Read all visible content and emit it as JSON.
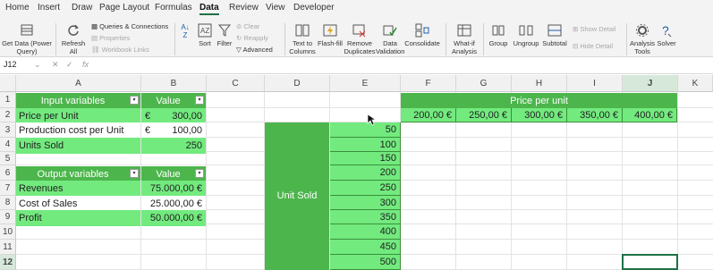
{
  "ribbon_tabs": [
    "Home",
    "Insert",
    "Draw",
    "Page Layout",
    "Formulas",
    "Data",
    "Review",
    "View",
    "Developer"
  ],
  "active_tab": "Data",
  "ribbon": {
    "get_data": "Get Data (Power Query)",
    "refresh_all": "Refresh All",
    "queries": "Queries & Connections",
    "properties": "Properties",
    "workbook_links": "Workbook Links",
    "sort": "Sort",
    "filter": "Filter",
    "clear": "Clear",
    "reapply": "Reapply",
    "advanced": "Advanced",
    "text_to_columns": "Text to Columns",
    "flash_fill": "Flash-fill",
    "remove_duplicates": "Remove Duplicates",
    "data_validation": "Data Validation",
    "consolidate": "Consolidate",
    "what_if": "What-if Analysis",
    "group": "Group",
    "ungroup": "Ungroup",
    "subtotal": "Subtotal",
    "show_detail": "Show Detail",
    "hide_detail": "Hide Detail",
    "analysis_tools": "Analysis Tools",
    "solver": "Solver"
  },
  "formula_bar": {
    "name_box": "J12",
    "fx": "fx",
    "content": ""
  },
  "columns": [
    "A",
    "B",
    "C",
    "D",
    "E",
    "F",
    "G",
    "H",
    "I",
    "J",
    "K"
  ],
  "rows": [
    "1",
    "2",
    "3",
    "4",
    "5",
    "6",
    "7",
    "8",
    "9",
    "10",
    "11",
    "12"
  ],
  "input_table": {
    "header": [
      "Input variables",
      "Value"
    ],
    "rows": [
      {
        "label": "Price per Unit",
        "cur": "€",
        "value": "300,00"
      },
      {
        "label": "Production cost per Unit",
        "cur": "€",
        "value": "100,00"
      },
      {
        "label": "Units Sold",
        "cur": "",
        "value": "250"
      }
    ]
  },
  "output_table": {
    "header": [
      "Output variables",
      "Value"
    ],
    "rows": [
      {
        "label": "Revenues",
        "value": "75.000,00 €"
      },
      {
        "label": "Cost of Sales",
        "value": "25.000,00 €"
      },
      {
        "label": "Profit",
        "value": "50.000,00 €"
      }
    ]
  },
  "price_header": "Price per unit",
  "prices": [
    "200,00 €",
    "250,00 €",
    "300,00 €",
    "350,00 €",
    "400,00 €"
  ],
  "unit_sold_label": "Unit Sold",
  "units": [
    "50",
    "100",
    "150",
    "200",
    "250",
    "300",
    "350",
    "400",
    "450",
    "500"
  ],
  "colors": {
    "green": "#72ea7e",
    "dark_green": "#4cb64c",
    "accent": "#1e7145"
  }
}
